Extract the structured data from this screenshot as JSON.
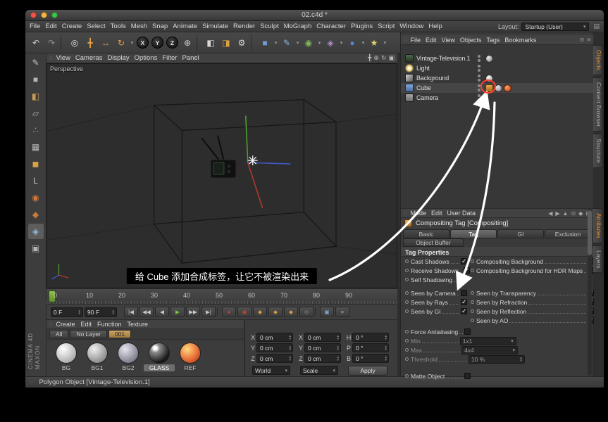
{
  "window": {
    "title": "02.c4d *",
    "status_text": "Polygon Object [Vintage-Television.1]"
  },
  "menubar": {
    "items": [
      "File",
      "Edit",
      "Create",
      "Select",
      "Tools",
      "Mesh",
      "Snap",
      "Animate",
      "Simulate",
      "Render",
      "Sculpt",
      "MoGraph",
      "Character",
      "Plugins",
      "Script",
      "Window",
      "Help"
    ],
    "layout_label": "Layout:",
    "layout_value": "Startup (User)"
  },
  "toolbar": {
    "icons": [
      {
        "name": "undo-icon",
        "glyph": "↶",
        "fg": "#cccccc"
      },
      {
        "name": "redo-icon",
        "glyph": "↷",
        "fg": "#8f8f8f"
      },
      {
        "name": "toolbar-separator",
        "cls": "sep"
      },
      {
        "name": "live-selection-icon",
        "glyph": "◎",
        "fg": "#e2e2e2"
      },
      {
        "name": "move-tool-icon",
        "glyph": "╋",
        "fg": "#e09f43"
      },
      {
        "name": "scale-tool-icon",
        "glyph": "↔",
        "fg": "#e09f43"
      },
      {
        "name": "rotate-tool-icon",
        "glyph": "↻",
        "fg": "#e09f43"
      },
      {
        "name": "tool-history-dropdown",
        "glyph": "▾",
        "cls": "dd"
      },
      {
        "name": "x-axis-lock-button",
        "glyph": "X",
        "cls": "axis"
      },
      {
        "name": "y-axis-lock-button",
        "glyph": "Y",
        "cls": "axis"
      },
      {
        "name": "z-axis-lock-button",
        "glyph": "Z",
        "cls": "axis"
      },
      {
        "name": "coordinate-system-button",
        "glyph": "⊕",
        "fg": "#cfcfcf"
      },
      {
        "name": "toolbar-separator",
        "cls": "sep"
      },
      {
        "name": "render-view-button",
        "glyph": "◧",
        "fg": "#d8d8d8"
      },
      {
        "name": "render-picture-viewer-button",
        "glyph": "◨",
        "fg": "#d9a23f"
      },
      {
        "name": "render-settings-button",
        "glyph": "⚙",
        "fg": "#d8d8d8"
      },
      {
        "name": "toolbar-separator",
        "cls": "sep"
      },
      {
        "name": "cube-primitive-button",
        "glyph": "■",
        "fg": "#6f9ed6"
      },
      {
        "name": "primitive-dropdown",
        "glyph": "▾",
        "cls": "dd"
      },
      {
        "name": "spline-pen-button",
        "glyph": "✎",
        "fg": "#8fb7e0"
      },
      {
        "name": "spline-dropdown",
        "glyph": "▾",
        "cls": "dd"
      },
      {
        "name": "subdivision-surface-button",
        "glyph": "◉",
        "fg": "#7cb852"
      },
      {
        "name": "generator-dropdown",
        "glyph": "▾",
        "cls": "dd"
      },
      {
        "name": "deformer-button",
        "glyph": "◈",
        "fg": "#b28fca"
      },
      {
        "name": "deformer-dropdown",
        "glyph": "▾",
        "cls": "dd"
      },
      {
        "name": "environment-button",
        "glyph": "●",
        "fg": "#5583cf"
      },
      {
        "name": "environment-dropdown",
        "glyph": "▾",
        "cls": "dd"
      },
      {
        "name": "light-button",
        "glyph": "★",
        "fg": "#e3d372"
      },
      {
        "name": "light-dropdown",
        "glyph": "▾",
        "cls": "dd"
      }
    ]
  },
  "left_toolbar": {
    "icons": [
      {
        "name": "make-editable-icon",
        "glyph": "✎",
        "fg": "#c2c2c2"
      },
      {
        "name": "model-mode-icon",
        "glyph": "■",
        "fg": "#b5b5b5"
      },
      {
        "name": "texture-mode-icon",
        "glyph": "◧",
        "fg": "#c89b5a"
      },
      {
        "name": "workplane-mode-icon",
        "glyph": "▱",
        "fg": "#b5b5b5"
      },
      {
        "name": "point-mode-icon",
        "glyph": "∴",
        "fg": "#d6a044"
      },
      {
        "name": "edge-mode-icon",
        "glyph": "▦",
        "fg": "#b5b5b5"
      },
      {
        "name": "polygon-mode-icon",
        "glyph": "◼",
        "fg": "#d6a044"
      },
      {
        "name": "enable-axis-icon",
        "glyph": "L",
        "fg": "#c2c2c2"
      },
      {
        "name": "snap-settings-icon",
        "glyph": "◉",
        "fg": "#d07b3a"
      },
      {
        "name": "locked-workplane-icon",
        "glyph": "◆",
        "fg": "#c77b3a"
      },
      {
        "name": "texture-axis-icon",
        "glyph": "◈",
        "fg": "#8fb7e0",
        "cls": "selected"
      },
      {
        "name": "viewport-solo-icon",
        "glyph": "▣",
        "fg": "#b5b5b5"
      }
    ],
    "branding_line1": "MAXON",
    "branding_line2": "CINEMA 4D"
  },
  "viewport": {
    "menu": [
      "View",
      "Cameras",
      "Display",
      "Options",
      "Filter",
      "Panel"
    ],
    "corner_icons": [
      {
        "name": "pan-view-icon",
        "glyph": "╋"
      },
      {
        "name": "zoom-view-icon",
        "glyph": "⊕"
      },
      {
        "name": "rotate-view-icon",
        "glyph": "↻"
      },
      {
        "name": "maximize-view-icon",
        "glyph": "▣"
      }
    ],
    "label": "Perspective",
    "subtitle": "给 Cube 添加合成标签，让它不被渲染出来"
  },
  "timeline": {
    "ticks": [
      "0",
      "10",
      "20",
      "30",
      "40",
      "50",
      "60",
      "70",
      "80",
      "90"
    ]
  },
  "transport": {
    "start_frame": "0 F",
    "end_frame": "90 F",
    "buttons": [
      {
        "name": "goto-start-button",
        "glyph": "|◀"
      },
      {
        "name": "previous-frame-button",
        "glyph": "◀◀"
      },
      {
        "name": "play-backwards-button",
        "glyph": "◀"
      },
      {
        "name": "play-button",
        "glyph": "▶",
        "fg": "#7ac142"
      },
      {
        "name": "next-frame-button",
        "glyph": "▶▶"
      },
      {
        "name": "goto-end-button",
        "glyph": "▶|"
      },
      {
        "name": "transport-separator",
        "cls": "sep"
      },
      {
        "name": "record-button",
        "glyph": "●",
        "fg": "#cf4434"
      },
      {
        "name": "autokey-button",
        "glyph": "◉",
        "fg": "#cf4434"
      },
      {
        "name": "record-position-icon",
        "glyph": "◆",
        "fg": "#d89a3c"
      },
      {
        "name": "record-scale-icon",
        "glyph": "◆",
        "fg": "#d89a3c"
      },
      {
        "name": "record-rotation-icon",
        "glyph": "◆",
        "fg": "#d89a3c"
      },
      {
        "name": "record-pla-icon",
        "glyph": "◇",
        "fg": "#ababab"
      },
      {
        "name": "transport-separator",
        "cls": "sep"
      },
      {
        "name": "solo-button",
        "glyph": "▣",
        "fg": "#7ea7d8"
      },
      {
        "name": "transport-options-button",
        "glyph": "≡",
        "fg": "#ababab"
      }
    ]
  },
  "materials": {
    "menu": [
      "Create",
      "Edit",
      "Function",
      "Texture"
    ],
    "layer_tabs": [
      {
        "label": "All"
      },
      {
        "label": "No Layer"
      },
      {
        "label": "001",
        "cls": "tan"
      }
    ],
    "items": [
      {
        "label": "BG",
        "kind": "sph-bg"
      },
      {
        "label": "BG1",
        "kind": "sph-bg1"
      },
      {
        "label": "BG2",
        "kind": "sph-bg2"
      },
      {
        "label": "GLASS",
        "kind": "sph-glass",
        "sel": "selected"
      },
      {
        "label": "REF",
        "kind": "sph-ref"
      }
    ]
  },
  "coordinates": {
    "rows": [
      {
        "pl": "X",
        "pv": "0 cm",
        "sl": "X",
        "sv": "0 cm",
        "rl": "H",
        "rv": "0 °"
      },
      {
        "pl": "Y",
        "pv": "0 cm",
        "sl": "Y",
        "sv": "0 cm",
        "rl": "P",
        "rv": "0 °"
      },
      {
        "pl": "Z",
        "pv": "0 cm",
        "sl": "Z",
        "sv": "0 cm",
        "rl": "B",
        "rv": "0 °"
      }
    ],
    "mode1": "World",
    "mode2": "Scale",
    "apply_label": "Apply"
  },
  "object_manager": {
    "menu": [
      "File",
      "Edit",
      "View",
      "Objects",
      "Tags",
      "Bookmarks"
    ],
    "corner_icons": [
      {
        "name": "om-search-icon",
        "glyph": "⊙"
      },
      {
        "name": "om-options-icon",
        "glyph": "≡"
      }
    ],
    "objects": [
      {
        "name": "Vintage-Television.1"
      },
      {
        "name": "Light"
      },
      {
        "name": "Background"
      },
      {
        "name": "Cube"
      },
      {
        "name": "Camera"
      }
    ]
  },
  "attributes": {
    "menu": [
      "Mode",
      "Edit",
      "User Data"
    ],
    "nav_icons": [
      {
        "name": "back-icon",
        "glyph": "◀"
      },
      {
        "name": "forward-icon",
        "glyph": "▶"
      },
      {
        "name": "up-icon",
        "glyph": "▲"
      },
      {
        "name": "search-icon",
        "glyph": "⊙"
      },
      {
        "name": "key-icon",
        "glyph": "◆"
      },
      {
        "name": "panel-icon",
        "glyph": "⊞"
      }
    ],
    "title": "Compositing Tag [Compositing]",
    "tabs": [
      {
        "label": "Basic"
      },
      {
        "label": "Tag",
        "active": "active"
      },
      {
        "label": "GI"
      },
      {
        "label": "Exclusion"
      }
    ],
    "buffer_tab": "Object Buffer",
    "section": "Tag Properties",
    "left": [
      {
        "label": "Cast Shadows",
        "checked": true
      },
      {
        "label": "Receive Shadows",
        "checked": true
      },
      {
        "label": "Self Shadowing",
        "checked": true
      },
      {
        "label": "Seen by Camera",
        "checked": false
      },
      {
        "label": "Seen by Rays",
        "checked": true
      },
      {
        "label": "Seen by GI",
        "checked": true
      }
    ],
    "right": [
      {
        "label": "Compositing Background",
        "checked": false
      },
      {
        "label": "Compositing Background for HDR Maps",
        "checked": false
      },
      {
        "label": "Seen by Transparency",
        "checked": true
      },
      {
        "label": "Seen by Refraction",
        "checked": true
      },
      {
        "label": "Seen by Reflection",
        "checked": true
      },
      {
        "label": "Seen by AO",
        "checked": true
      }
    ],
    "force_aa": {
      "label": "Force Antialiasing",
      "checked": false
    },
    "min": {
      "label": "Min",
      "value": "1x1"
    },
    "max": {
      "label": "Max",
      "value": "4x4"
    },
    "threshold": {
      "label": "Threshold",
      "value": "10 %"
    },
    "matte": {
      "label": "Matte Object",
      "checked": false
    }
  },
  "side_tabs": {
    "top": [
      {
        "label": "Objects",
        "active": "active"
      },
      {
        "label": "Content Browser"
      },
      {
        "label": "Structure"
      }
    ],
    "bottom": [
      {
        "label": "Attributes",
        "active": "active"
      },
      {
        "label": "Layers"
      }
    ]
  }
}
